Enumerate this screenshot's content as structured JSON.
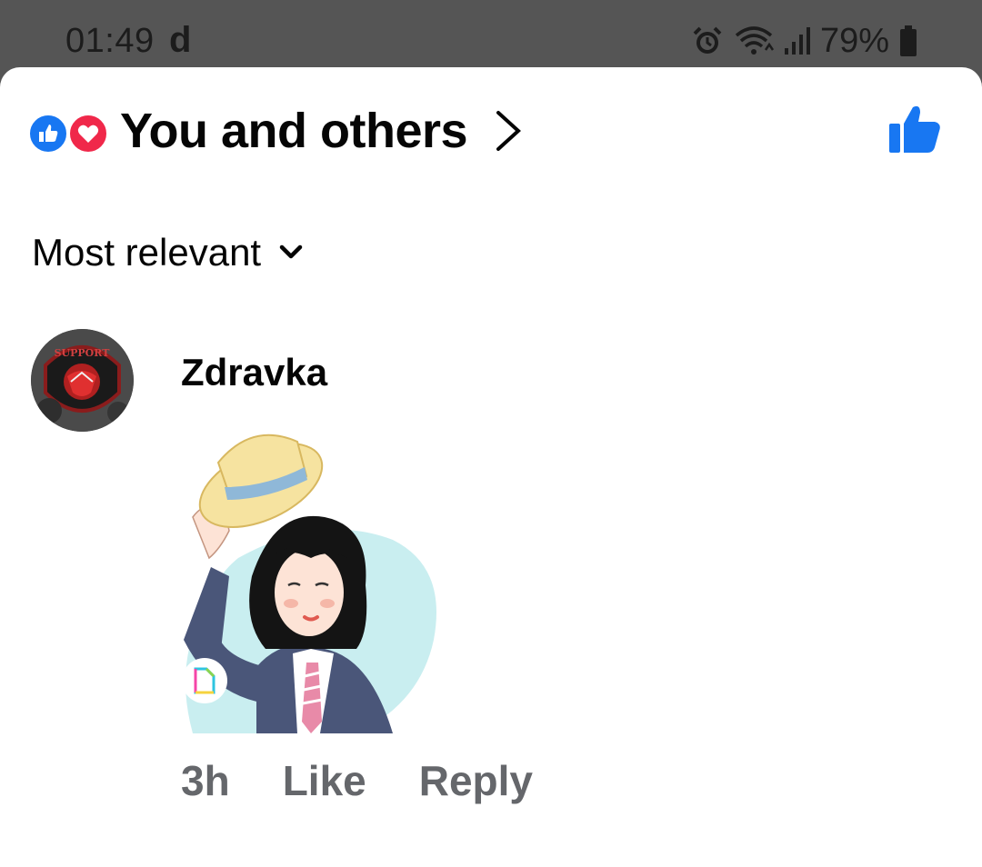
{
  "status_bar": {
    "time": "01:49",
    "notification_glyph": "d",
    "battery": "79%",
    "icons": [
      "alarm-icon",
      "wifi-icon",
      "signal-icon",
      "battery-icon"
    ]
  },
  "header": {
    "reaction_icons": [
      "like-reaction-icon",
      "love-reaction-icon"
    ],
    "title": "You and others",
    "chevron": "chevron-right-icon",
    "action_icon": "thumbs-up-icon"
  },
  "sort": {
    "label": "Most relevant",
    "icon": "chevron-down-icon"
  },
  "comment": {
    "author": "Zdravka",
    "avatar_text": "SUPPORT",
    "attachment": "sticker",
    "time": "3h",
    "like_label": "Like",
    "reply_label": "Reply"
  },
  "colors": {
    "brand_blue": "#1877f2",
    "love_red": "#f0284a",
    "muted_text": "#65676b",
    "status_bg": "#555555"
  }
}
